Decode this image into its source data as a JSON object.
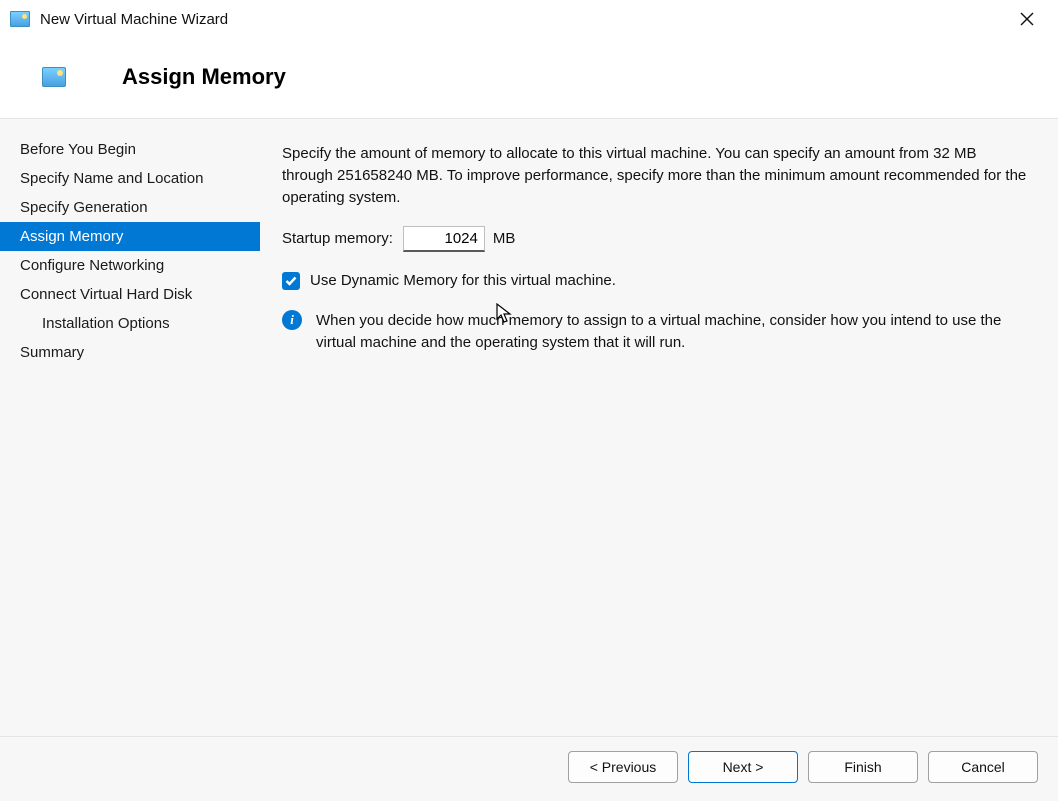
{
  "window": {
    "title": "New Virtual Machine Wizard"
  },
  "header": {
    "title": "Assign Memory"
  },
  "sidebar": {
    "steps": [
      {
        "label": "Before You Begin",
        "selected": false,
        "sub": false
      },
      {
        "label": "Specify Name and Location",
        "selected": false,
        "sub": false
      },
      {
        "label": "Specify Generation",
        "selected": false,
        "sub": false
      },
      {
        "label": "Assign Memory",
        "selected": true,
        "sub": false
      },
      {
        "label": "Configure Networking",
        "selected": false,
        "sub": false
      },
      {
        "label": "Connect Virtual Hard Disk",
        "selected": false,
        "sub": false
      },
      {
        "label": "Installation Options",
        "selected": false,
        "sub": true
      },
      {
        "label": "Summary",
        "selected": false,
        "sub": false
      }
    ]
  },
  "content": {
    "intro": "Specify the amount of memory to allocate to this virtual machine. You can specify an amount from 32 MB through 251658240 MB. To improve performance, specify more than the minimum amount recommended for the operating system.",
    "memory_label": "Startup memory:",
    "memory_value": "1024",
    "memory_unit": "MB",
    "dynamic_checkbox_checked": true,
    "dynamic_checkbox_label": "Use Dynamic Memory for this virtual machine.",
    "info_text": "When you decide how much memory to assign to a virtual machine, consider how you intend to use the virtual machine and the operating system that it will run."
  },
  "footer": {
    "previous": "< Previous",
    "next": "Next >",
    "finish": "Finish",
    "cancel": "Cancel"
  }
}
